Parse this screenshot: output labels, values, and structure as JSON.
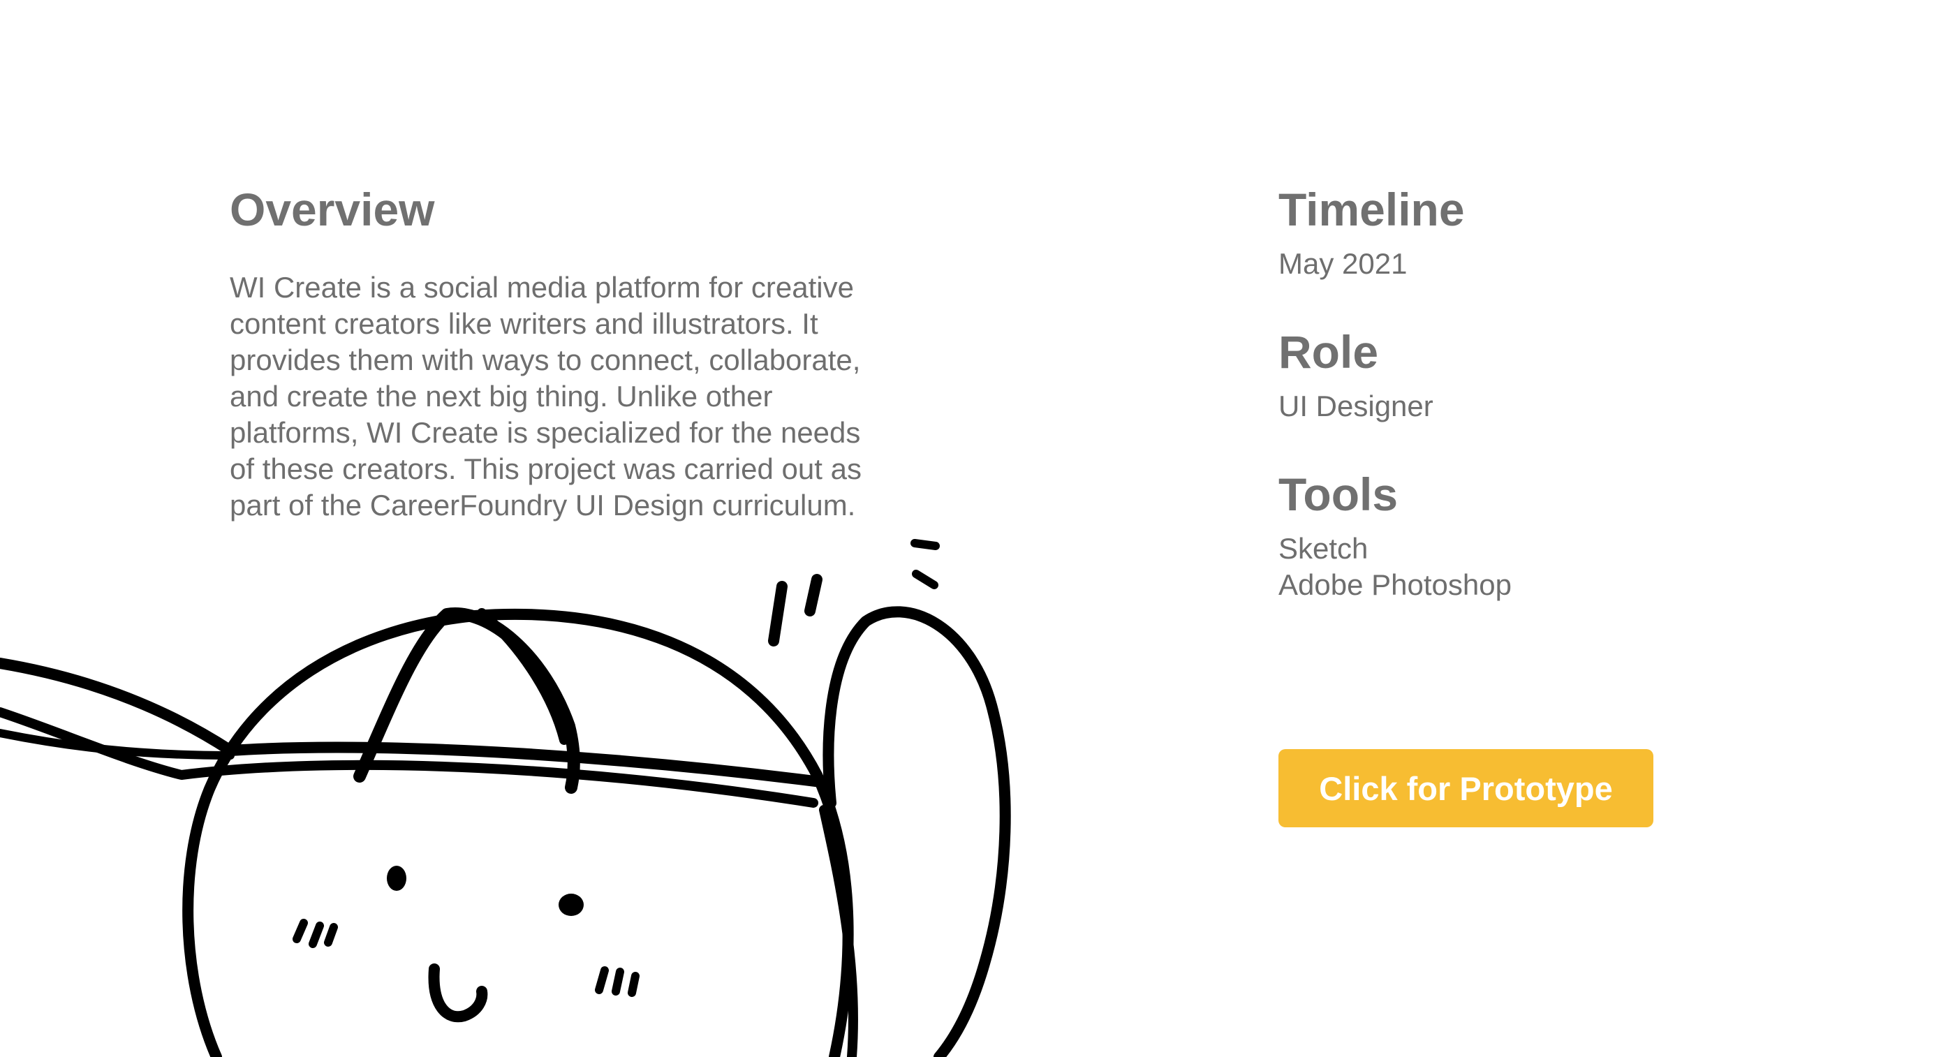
{
  "overview": {
    "heading": "Overview",
    "body": "WI Create is a social media platform for creative content creators like writers and illustrators. It provides them with ways to connect, collaborate, and create the next big thing. Unlike other platforms, WI Create is specialized for the needs of these creators. This project was carried out as part of the CareerFoundry UI Design curriculum."
  },
  "details": {
    "timeline_heading": "Timeline",
    "timeline_value": "May 2021",
    "role_heading": "Role",
    "role_value": "UI Designer",
    "tools_heading": "Tools",
    "tools": [
      "Sketch",
      "Adobe Photoshop"
    ]
  },
  "cta": {
    "label": "Click for Prototype",
    "color": "#f7bd32"
  },
  "illustration": {
    "icon": "doodle-character-illustration"
  }
}
